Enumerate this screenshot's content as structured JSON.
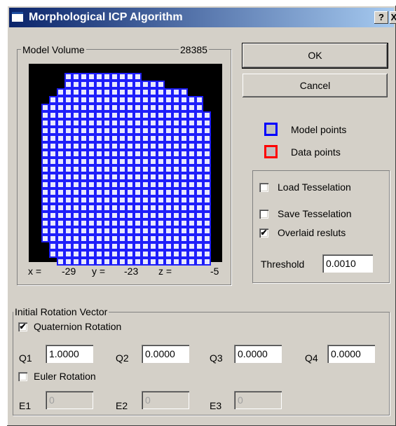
{
  "window": {
    "title": "Morphological ICP Algorithm",
    "help_label": "?",
    "close_label": "X"
  },
  "model_volume": {
    "label": "Model Volume",
    "count": "28385",
    "coords": {
      "x_label": "x =",
      "x": "-29",
      "y_label": "y =",
      "y": "-23",
      "z_label": "z =",
      "z": "-5"
    },
    "colors": {
      "background": "#000000",
      "cell_border": "#1e1efa",
      "cell_fill": "#e8e8ff"
    }
  },
  "buttons": {
    "ok": "OK",
    "cancel": "Cancel"
  },
  "legend": {
    "model": {
      "label": "Model points",
      "color": "#0000ff"
    },
    "data": {
      "label": "Data points",
      "color": "#ff0000"
    }
  },
  "options": {
    "load_tesselation": {
      "label": "Load Tesselation",
      "checked": false
    },
    "save_tesselation": {
      "label": "Save Tesselation",
      "checked": false
    },
    "overlaid_results": {
      "label": "Overlaid resluts",
      "checked": true
    },
    "threshold_label": "Threshold",
    "threshold_value": "0.0010"
  },
  "rotation": {
    "group_label": "Initial Rotation Vector",
    "quaternion": {
      "label": "Quaternion Rotation",
      "checked": true,
      "q1_label": "Q1",
      "q1": "1.0000",
      "q2_label": "Q2",
      "q2": "0.0000",
      "q3_label": "Q3",
      "q3": "0.0000",
      "q4_label": "Q4",
      "q4": "0.0000"
    },
    "euler": {
      "label": "Euler Rotation",
      "checked": false,
      "e1_label": "E1",
      "e1": "0",
      "e2_label": "E2",
      "e2": "0",
      "e3_label": "E3",
      "e3": "0"
    }
  },
  "check_glyph": "✔"
}
